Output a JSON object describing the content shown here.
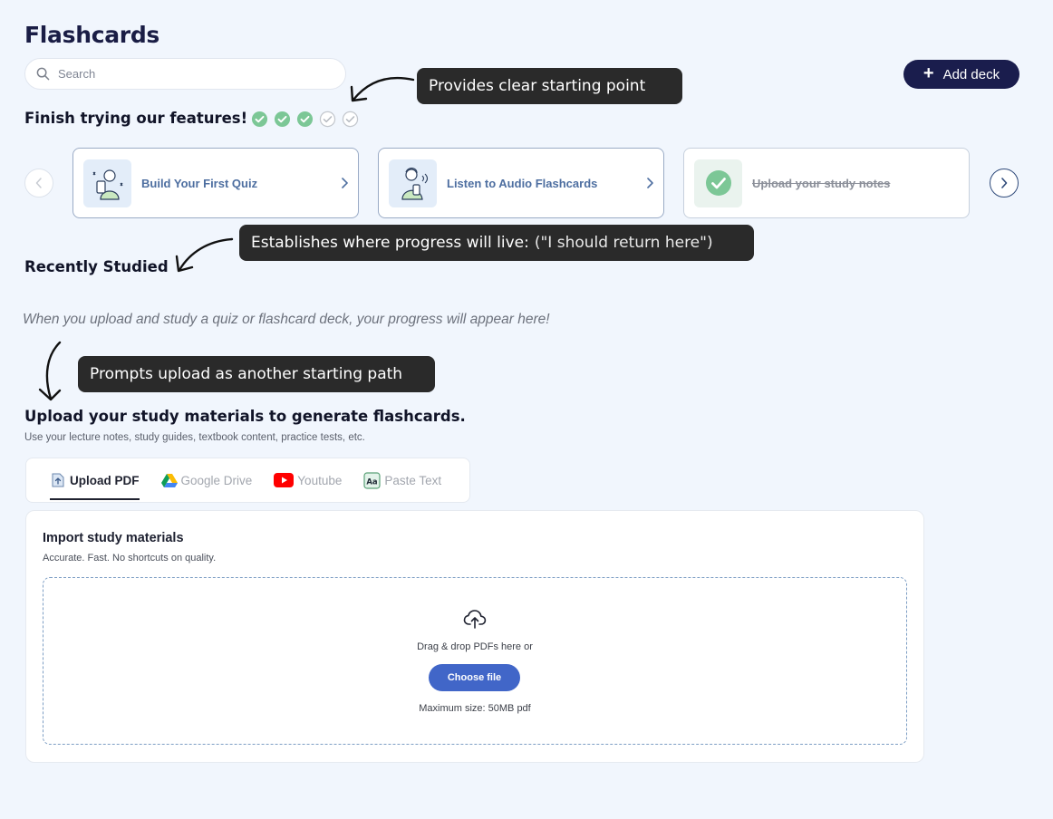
{
  "page": {
    "title": "Flashcards"
  },
  "search": {
    "placeholder": "Search"
  },
  "add_deck": {
    "label": "Add deck"
  },
  "annotations": {
    "starting_point": "Provides clear starting point",
    "progress_main": "Establishes where progress will live:",
    "progress_quote": "(\"I should return here\")",
    "upload_path": "Prompts upload as another starting path"
  },
  "features": {
    "title": "Finish trying our features!",
    "progress": {
      "completed": 3,
      "total": 5
    },
    "cards": [
      {
        "label": "Build Your First Quiz",
        "completed": false
      },
      {
        "label": "Listen to Audio Flashcards",
        "completed": false
      },
      {
        "label": "Upload your study notes",
        "completed": true
      }
    ]
  },
  "recent": {
    "title": "Recently Studied",
    "empty_message": "When you upload and study a quiz or flashcard deck, your progress will appear here!"
  },
  "upload": {
    "title": "Upload your study materials to generate flashcards.",
    "subtitle": "Use your lecture notes, study guides, textbook content, practice tests, etc.",
    "tabs": [
      {
        "label": "Upload PDF",
        "active": true
      },
      {
        "label": "Google Drive",
        "active": false
      },
      {
        "label": "Youtube",
        "active": false
      },
      {
        "label": "Paste Text",
        "active": false
      }
    ]
  },
  "import": {
    "title": "Import study materials",
    "subtitle": "Accurate. Fast. No shortcuts on quality.",
    "drop_text": "Drag & drop PDFs here or",
    "choose_label": "Choose file",
    "max_size": "Maximum size: 50MB pdf"
  },
  "colors": {
    "background": "#f1f6fd",
    "navy": "#1a1d4d",
    "accent_blue": "#4166c8",
    "check_green": "#7cc796",
    "bubble_dark": "#2a2a2a"
  }
}
